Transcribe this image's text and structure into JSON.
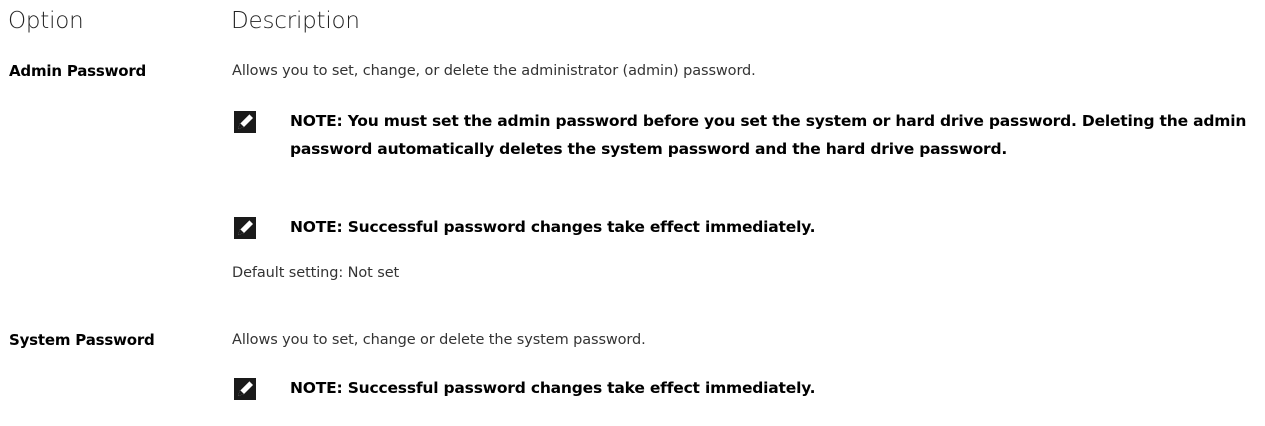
{
  "header": {
    "option": "Option",
    "description": "Description"
  },
  "rows": [
    {
      "option": "Admin Password",
      "description": "Allows you to set, change, or delete the administrator (admin) password.",
      "notes": [
        "NOTE: You must set the admin password before you set the system or hard drive password. Deleting the admin password automatically deletes the system password and the hard drive password.",
        "NOTE: Successful password changes take effect immediately."
      ],
      "default": "Default setting: Not set"
    },
    {
      "option": "System Password",
      "description": "Allows you to set, change or delete the system password.",
      "notes": [
        "NOTE: Successful password changes take effect immediately."
      ]
    }
  ],
  "icons": {
    "note": "pencil-note-icon"
  }
}
